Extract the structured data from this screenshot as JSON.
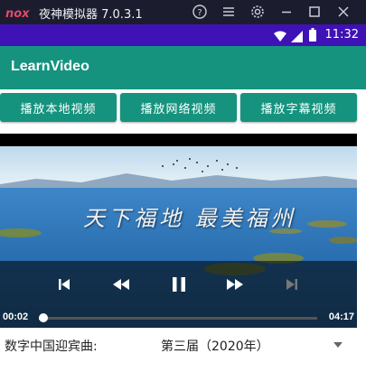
{
  "emulator": {
    "title": "夜神模拟器 7.0.3.1",
    "logo_text": "nox",
    "controls": [
      "help-icon",
      "menu-icon",
      "settings-icon",
      "minimize-icon",
      "maximize-icon",
      "close-icon"
    ]
  },
  "status_bar": {
    "time": "11:32",
    "icons": [
      "wifi-icon",
      "signal-icon",
      "battery-icon"
    ]
  },
  "app_bar": {
    "title": "LearnVideo"
  },
  "buttons": {
    "local": "播放本地视频",
    "network": "播放网络视频",
    "subtitle": "播放字幕视频"
  },
  "player": {
    "overlay_text": "天下福地 最美福州",
    "current_time": "00:02",
    "total_time": "04:17",
    "progress_fraction": 0.008,
    "controls": [
      "skip-previous-icon",
      "rewind-icon",
      "pause-icon",
      "fast-forward-icon",
      "skip-next-icon"
    ]
  },
  "spinner": {
    "label": "数字中国迎宾曲:",
    "selected": "第三届（2020年）"
  },
  "colors": {
    "emulator_bar": "#1b1d2e",
    "status_bar": "#3f12b6",
    "accent": "#15937f"
  }
}
